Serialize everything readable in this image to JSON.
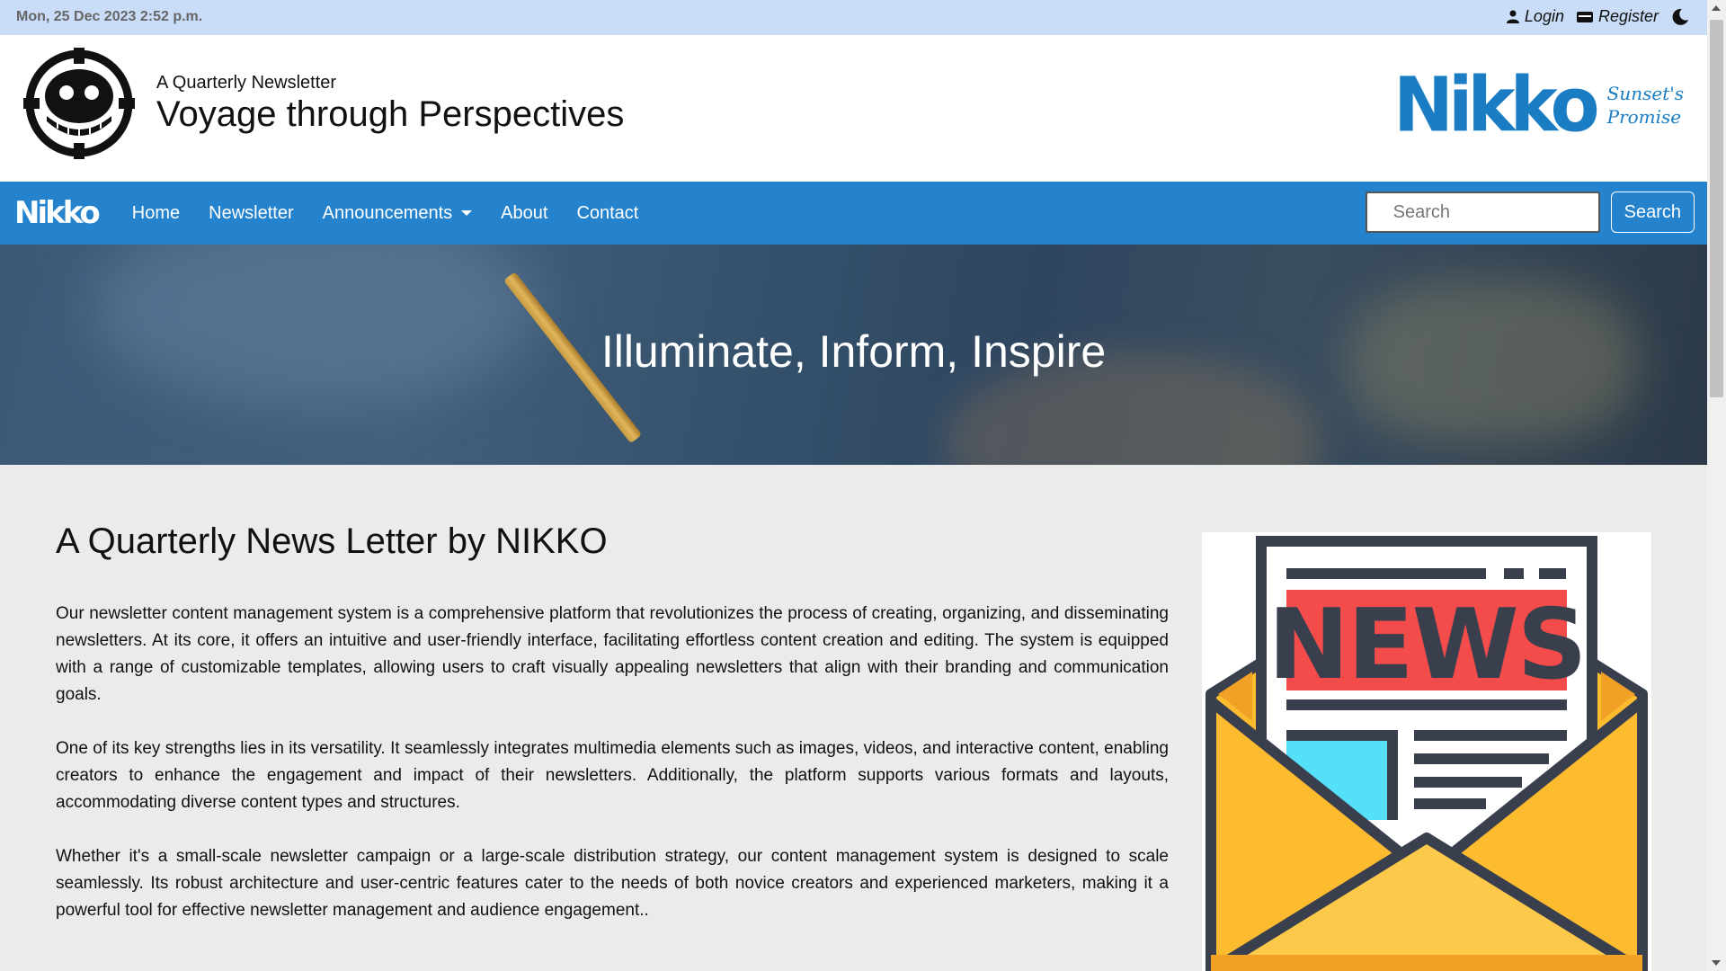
{
  "topbar": {
    "date": "Mon, 25 Dec 2023 2:52 p.m.",
    "login_label": "Login",
    "register_label": "Register",
    "icons": [
      "user-icon",
      "id-card-icon",
      "moon-icon"
    ]
  },
  "header": {
    "subtitle": "A Quarterly Newsletter",
    "title": "Voyage through Perspectives",
    "brand_logo": {
      "wordmark": "Nikko",
      "tagline_line1": "Sunset's",
      "tagline_line2": "Promise"
    }
  },
  "nav": {
    "brand": "Nikko",
    "items": [
      {
        "label": "Home"
      },
      {
        "label": "Newsletter"
      },
      {
        "label": "Announcements"
      },
      {
        "label": "About"
      },
      {
        "label": "Contact"
      }
    ],
    "search_placeholder": "Search",
    "search_button": "Search"
  },
  "hero": {
    "heading": "Illuminate, Inform, Inspire"
  },
  "main": {
    "heading": "A Quarterly News Letter by NIKKO",
    "paragraphs": [
      "Our newsletter content management system is a comprehensive platform that revolutionizes the process of creating, organizing, and disseminating newsletters. At its core, it offers an intuitive and user-friendly interface, facilitating effortless content creation and editing. The system is equipped with a range of customizable templates, allowing users to craft visually appealing newsletters that align with their branding and communication goals.",
      "One of its key strengths lies in its versatility. It seamlessly integrates multimedia elements such as images, videos, and interactive content, enabling creators to enhance the engagement and impact of their newsletters. Additionally, the platform supports various formats and layouts, accommodating diverse content types and structures.",
      "Whether it's a small-scale newsletter campaign or a large-scale distribution strategy, our content management system is designed to scale seamlessly. Its robust architecture and user-centric features cater to the needs of both novice creators and experienced marketers, making it a powerful tool for effective newsletter management and audience engagement.."
    ],
    "illustration_text": "NEWS"
  },
  "colors": {
    "topbar": "#c9dcf8",
    "nav": "#2583cd",
    "brand_blue": "#1a7dc4",
    "envelope": "#fcc441",
    "news_red": "#f44b4b",
    "outline": "#3a3f4e"
  }
}
